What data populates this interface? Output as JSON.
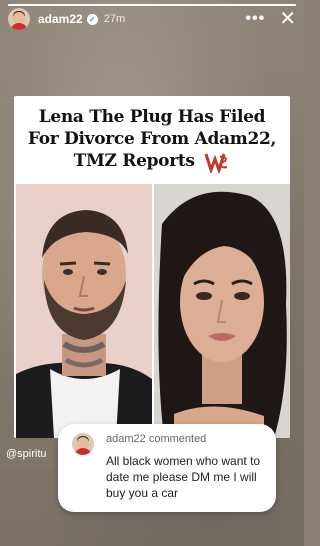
{
  "header": {
    "username": "adam22",
    "time": "27m",
    "more_glyph": "•••",
    "close_glyph": "✕"
  },
  "post": {
    "headline_line1": "Lena The Plug Has Filed",
    "headline_line2": "For Divorce From Adam22,",
    "headline_line3": "TMZ Reports"
  },
  "handle": "@spiritu",
  "comment": {
    "username": "adam22",
    "action": "commented",
    "text": "All black women who want to date me please DM me I will buy you a car"
  },
  "colors": {
    "accent_logo": "#c0392b",
    "background": "#8b8172"
  }
}
